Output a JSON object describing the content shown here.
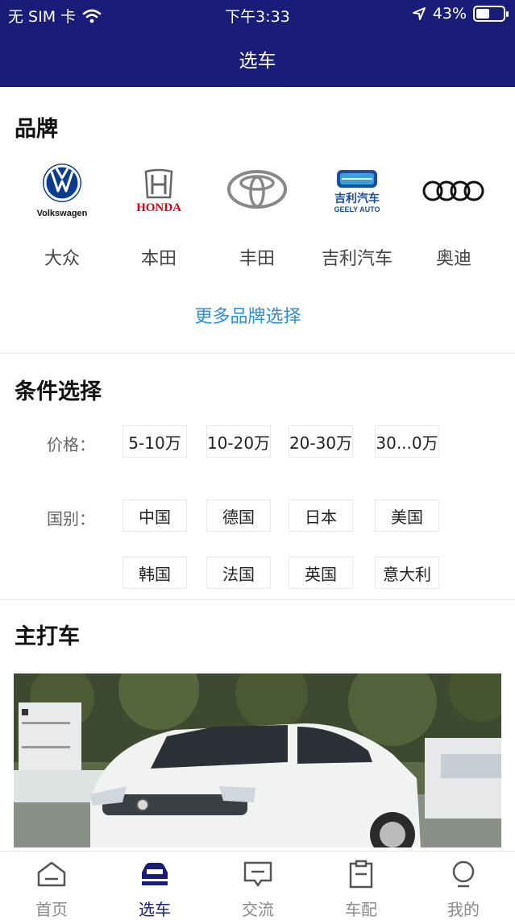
{
  "status_bar": {
    "carrier": "无 SIM 卡",
    "time": "下午3:33",
    "battery": "43%",
    "battery_level": 0.43
  },
  "nav": {
    "title": "选车"
  },
  "brands_section": {
    "title": "品牌",
    "items": [
      {
        "label": "大众",
        "logo": "volkswagen-logo",
        "logo_text": "Volkswagen"
      },
      {
        "label": "本田",
        "logo": "honda-logo",
        "logo_text": "HONDA"
      },
      {
        "label": "丰田",
        "logo": "toyota-logo"
      },
      {
        "label": "吉利汽车",
        "logo": "geely-logo",
        "logo_text": "吉利汽车",
        "logo_subtext": "GEELY AUTO"
      },
      {
        "label": "奥迪",
        "logo": "audi-logo"
      }
    ],
    "more_link": "更多品牌选择"
  },
  "filter_section": {
    "title": "条件选择",
    "price_label": "价格：",
    "price_options": [
      "5-10万",
      "10-20万",
      "20-30万",
      "30...0万"
    ],
    "country_label": "国别：",
    "country_options": [
      "中国",
      "德国",
      "日本",
      "美国",
      "韩国",
      "法国",
      "英国",
      "意大利"
    ]
  },
  "featured_section": {
    "title": "主打车",
    "image": "featured-car-photo"
  },
  "tab_bar": {
    "tabs": [
      {
        "label": "首页",
        "icon": "home-icon"
      },
      {
        "label": "选车",
        "icon": "car-icon",
        "active": true
      },
      {
        "label": "交流",
        "icon": "chat-icon"
      },
      {
        "label": "车配",
        "icon": "clipboard-icon"
      },
      {
        "label": "我的",
        "icon": "profile-icon"
      }
    ]
  },
  "colors": {
    "brand_navy": "#1a1c7a",
    "link_blue": "#2d8fe0",
    "honda_red": "#e60012"
  }
}
